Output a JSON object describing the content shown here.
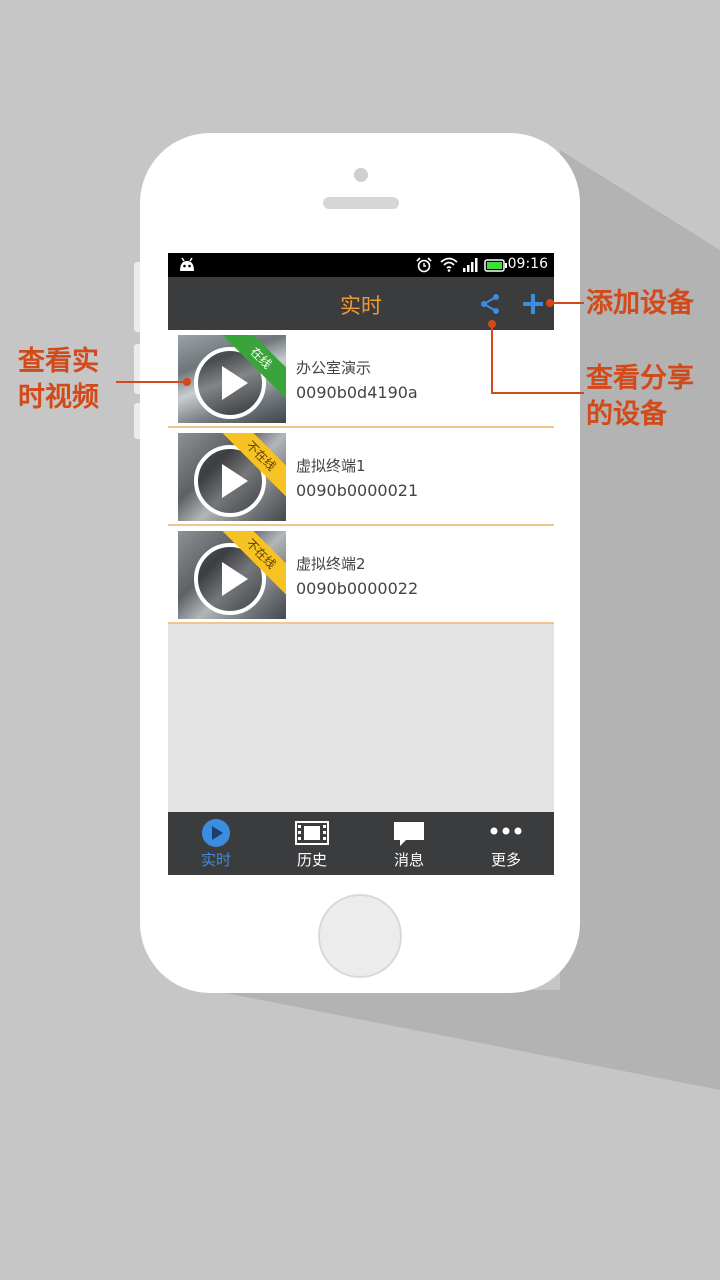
{
  "status": {
    "time": "09:16"
  },
  "appbar": {
    "title": "实时"
  },
  "devices": [
    {
      "name": "办公室演示",
      "serial": "0090b0d4190a",
      "status": "在线"
    },
    {
      "name": "虚拟终端1",
      "serial": "0090b0000021",
      "status": "不在线"
    },
    {
      "name": "虚拟终端2",
      "serial": "0090b0000022",
      "status": "不在线"
    }
  ],
  "tabs": [
    {
      "label": "实时",
      "icon": "play-circle-icon"
    },
    {
      "label": "历史",
      "icon": "film-icon"
    },
    {
      "label": "消息",
      "icon": "chat-bubble-icon"
    },
    {
      "label": "更多",
      "icon": "more-dots-icon"
    }
  ],
  "annotations": {
    "left": [
      "查看实",
      "时视频"
    ],
    "add": "添加设备",
    "share": [
      "查看分享",
      "的设备"
    ]
  },
  "colors": {
    "accent": "#f19a34",
    "tab_active": "#3c8ce0",
    "annotation": "#d24a1a",
    "online": "#3aa43a",
    "offline": "#f7c324"
  }
}
